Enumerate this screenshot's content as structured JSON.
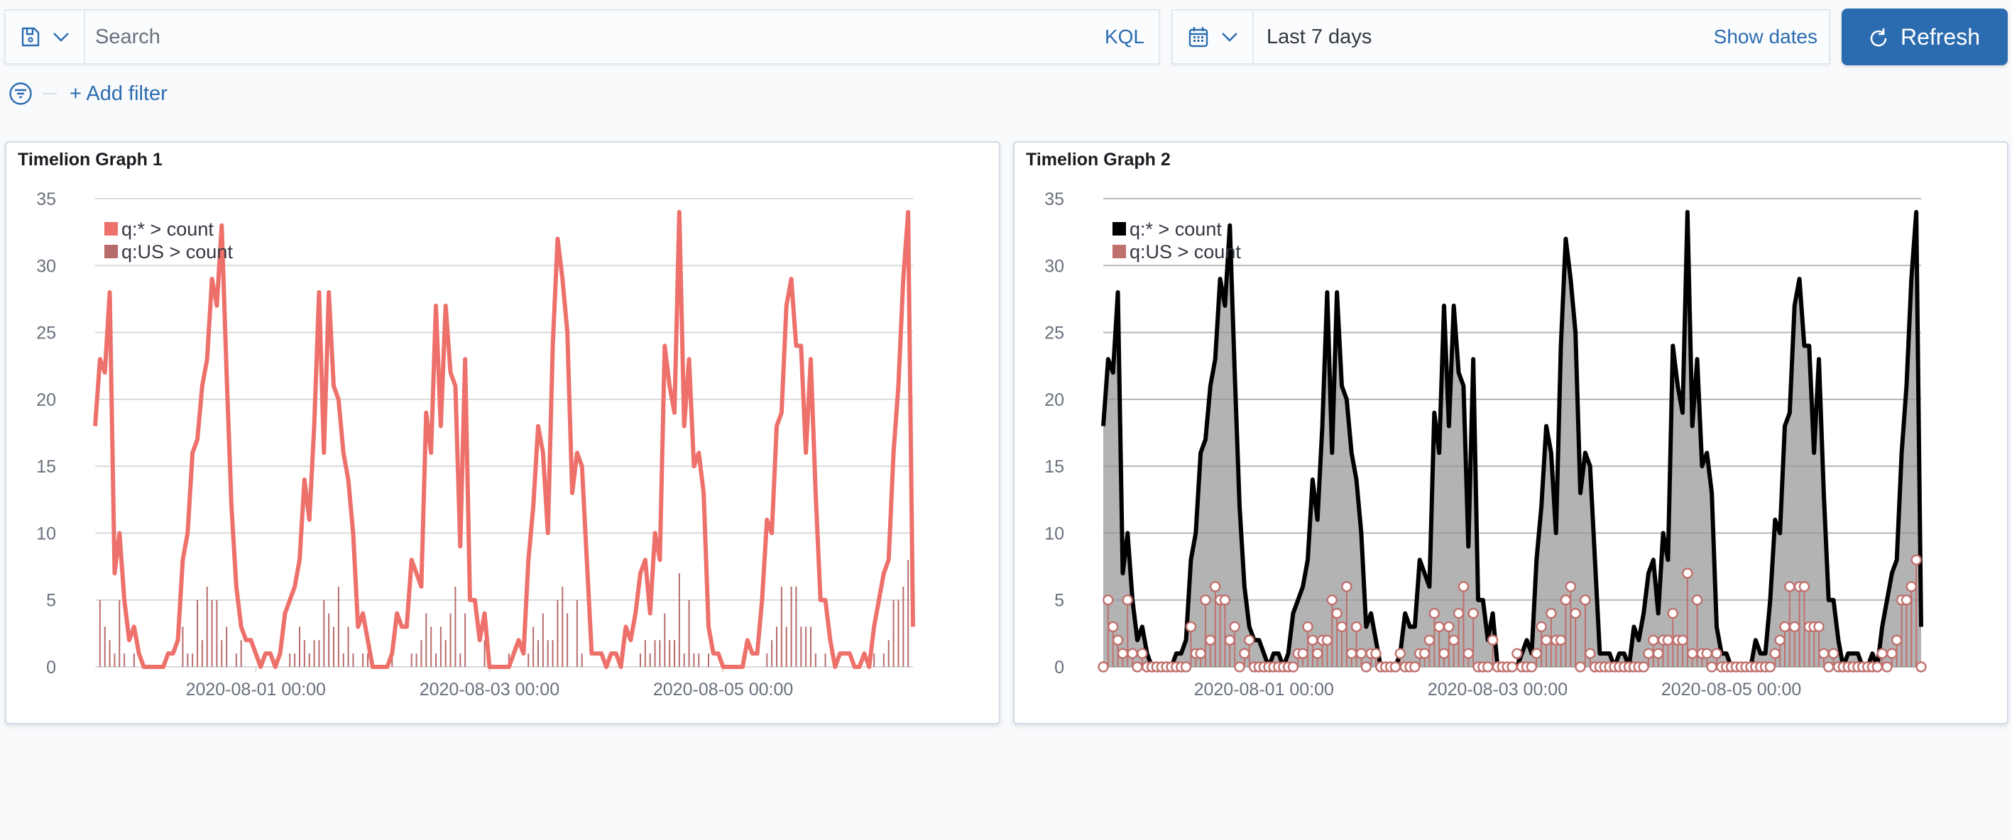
{
  "query_bar": {
    "search_placeholder": "Search",
    "search_value": "",
    "language_label": "KQL",
    "saved_query_icon": "save-icon",
    "date_picker_icon": "calendar-icon",
    "date_range": "Last 7 days",
    "show_dates_label": "Show dates",
    "refresh_label": "Refresh",
    "refresh_icon": "refresh-icon"
  },
  "filters": {
    "filter_icon": "filter-icon",
    "add_filter_label": "+ Add filter"
  },
  "colors": {
    "accent": "#2b6cb0",
    "link": "#2a6cb1",
    "graph1_total_line": "#ee706a",
    "graph1_us_bars": "#b86b6b",
    "graph2_total_line": "#000000",
    "graph2_total_fill": "#b3b3b3",
    "graph2_us_points": "#c0706d"
  },
  "panels": [
    {
      "title": "Timelion Graph 1"
    },
    {
      "title": "Timelion Graph 2"
    }
  ],
  "chart_data": [
    {
      "type": "line",
      "title": "Timelion Graph 1",
      "xlabel": "",
      "ylabel": "",
      "x_start": "2020-07-30 15:00",
      "x_interval": "1h",
      "x_end": "2020-08-06 15:00",
      "x_tick_labels": [
        "2020-08-01 00:00",
        "2020-08-03 00:00",
        "2020-08-05 00:00"
      ],
      "y_ticks": [
        0,
        5,
        10,
        15,
        20,
        25,
        30,
        35
      ],
      "ylim": [
        0,
        35
      ],
      "grid": true,
      "legend_position": "top-left",
      "series": [
        {
          "name": "q:* > count",
          "style": "line",
          "values": [
            18,
            23,
            22,
            28,
            7,
            10,
            5,
            2,
            3,
            1,
            0,
            0,
            0,
            0,
            0,
            1,
            1,
            2,
            8,
            10,
            16,
            17,
            21,
            23,
            29,
            27,
            33,
            22,
            12,
            6,
            3,
            2,
            2,
            1,
            0,
            1,
            1,
            0,
            1,
            4,
            5,
            6,
            8,
            14,
            11,
            18,
            28,
            16,
            28,
            21,
            20,
            16,
            14,
            10,
            3,
            4,
            2,
            0,
            0,
            0,
            0,
            1,
            4,
            3,
            3,
            8,
            7,
            6,
            19,
            16,
            27,
            18,
            27,
            22,
            21,
            9,
            23,
            5,
            5,
            2,
            4,
            0,
            0,
            0,
            0,
            0,
            1,
            2,
            1,
            8,
            12,
            18,
            16,
            10,
            24,
            32,
            29,
            25,
            13,
            16,
            15,
            8,
            1,
            1,
            1,
            0,
            1,
            1,
            0,
            3,
            2,
            4,
            7,
            8,
            4,
            10,
            8,
            24,
            21,
            19,
            34,
            18,
            23,
            15,
            16,
            13,
            3,
            1,
            1,
            0,
            0,
            0,
            0,
            0,
            2,
            1,
            1,
            5,
            11,
            10,
            18,
            19,
            27,
            29,
            24,
            24,
            16,
            23,
            13,
            5,
            5,
            2,
            0,
            1,
            1,
            1,
            0,
            0,
            1,
            0,
            3,
            5,
            7,
            8,
            16,
            21,
            29,
            34,
            3
          ]
        },
        {
          "name": "q:US > count",
          "style": "bars",
          "values": [
            0,
            5,
            3,
            2,
            1,
            5,
            1,
            0,
            1,
            0,
            0,
            0,
            0,
            0,
            0,
            0,
            0,
            0,
            3,
            1,
            1,
            5,
            2,
            6,
            5,
            5,
            2,
            3,
            0,
            1,
            2,
            0,
            0,
            0,
            0,
            0,
            0,
            0,
            0,
            0,
            1,
            1,
            3,
            2,
            1,
            2,
            2,
            5,
            4,
            3,
            6,
            1,
            3,
            1,
            0,
            1,
            1,
            0,
            0,
            0,
            0,
            1,
            0,
            0,
            0,
            1,
            1,
            2,
            4,
            3,
            1,
            3,
            2,
            4,
            6,
            1,
            4,
            0,
            0,
            0,
            2,
            0,
            0,
            0,
            0,
            1,
            0,
            0,
            0,
            1,
            3,
            2,
            4,
            2,
            2,
            5,
            6,
            4,
            0,
            5,
            1,
            0,
            0,
            0,
            0,
            0,
            0,
            0,
            0,
            0,
            0,
            0,
            1,
            2,
            1,
            2,
            2,
            4,
            2,
            2,
            7,
            1,
            5,
            1,
            1,
            0,
            1,
            0,
            0,
            0,
            0,
            0,
            0,
            0,
            0,
            0,
            0,
            0,
            1,
            2,
            3,
            6,
            3,
            6,
            6,
            3,
            3,
            3,
            1,
            0,
            1,
            0,
            0,
            0,
            0,
            0,
            0,
            0,
            0,
            0,
            1,
            0,
            1,
            2,
            5,
            5,
            6,
            8,
            0
          ]
        }
      ]
    },
    {
      "type": "area",
      "title": "Timelion Graph 2",
      "xlabel": "",
      "ylabel": "",
      "x_start": "2020-07-30 15:00",
      "x_interval": "1h",
      "x_end": "2020-08-06 15:00",
      "x_tick_labels": [
        "2020-08-01 00:00",
        "2020-08-03 00:00",
        "2020-08-05 00:00"
      ],
      "y_ticks": [
        0,
        5,
        10,
        15,
        20,
        25,
        30,
        35
      ],
      "ylim": [
        0,
        35
      ],
      "grid": true,
      "legend_position": "top-left",
      "series": [
        {
          "name": "q:* > count",
          "style": "area",
          "values": [
            18,
            23,
            22,
            28,
            7,
            10,
            5,
            2,
            3,
            1,
            0,
            0,
            0,
            0,
            0,
            1,
            1,
            2,
            8,
            10,
            16,
            17,
            21,
            23,
            29,
            27,
            33,
            22,
            12,
            6,
            3,
            2,
            2,
            1,
            0,
            1,
            1,
            0,
            1,
            4,
            5,
            6,
            8,
            14,
            11,
            18,
            28,
            16,
            28,
            21,
            20,
            16,
            14,
            10,
            3,
            4,
            2,
            0,
            0,
            0,
            0,
            1,
            4,
            3,
            3,
            8,
            7,
            6,
            19,
            16,
            27,
            18,
            27,
            22,
            21,
            9,
            23,
            5,
            5,
            2,
            4,
            0,
            0,
            0,
            0,
            0,
            1,
            2,
            1,
            8,
            12,
            18,
            16,
            10,
            24,
            32,
            29,
            25,
            13,
            16,
            15,
            8,
            1,
            1,
            1,
            0,
            1,
            1,
            0,
            3,
            2,
            4,
            7,
            8,
            4,
            10,
            8,
            24,
            21,
            19,
            34,
            18,
            23,
            15,
            16,
            13,
            3,
            1,
            1,
            0,
            0,
            0,
            0,
            0,
            2,
            1,
            1,
            5,
            11,
            10,
            18,
            19,
            27,
            29,
            24,
            24,
            16,
            23,
            13,
            5,
            5,
            2,
            0,
            1,
            1,
            1,
            0,
            0,
            1,
            0,
            3,
            5,
            7,
            8,
            16,
            21,
            29,
            34,
            3
          ]
        },
        {
          "name": "q:US > count",
          "style": "stem-points",
          "values": [
            0,
            5,
            3,
            2,
            1,
            5,
            1,
            0,
            1,
            0,
            0,
            0,
            0,
            0,
            0,
            0,
            0,
            0,
            3,
            1,
            1,
            5,
            2,
            6,
            5,
            5,
            2,
            3,
            0,
            1,
            2,
            0,
            0,
            0,
            0,
            0,
            0,
            0,
            0,
            0,
            1,
            1,
            3,
            2,
            1,
            2,
            2,
            5,
            4,
            3,
            6,
            1,
            3,
            1,
            0,
            1,
            1,
            0,
            0,
            0,
            0,
            1,
            0,
            0,
            0,
            1,
            1,
            2,
            4,
            3,
            1,
            3,
            2,
            4,
            6,
            1,
            4,
            0,
            0,
            0,
            2,
            0,
            0,
            0,
            0,
            1,
            0,
            0,
            0,
            1,
            3,
            2,
            4,
            2,
            2,
            5,
            6,
            4,
            0,
            5,
            1,
            0,
            0,
            0,
            0,
            0,
            0,
            0,
            0,
            0,
            0,
            0,
            1,
            2,
            1,
            2,
            2,
            4,
            2,
            2,
            7,
            1,
            5,
            1,
            1,
            0,
            1,
            0,
            0,
            0,
            0,
            0,
            0,
            0,
            0,
            0,
            0,
            0,
            1,
            2,
            3,
            6,
            3,
            6,
            6,
            3,
            3,
            3,
            1,
            0,
            1,
            0,
            0,
            0,
            0,
            0,
            0,
            0,
            0,
            0,
            1,
            0,
            1,
            2,
            5,
            5,
            6,
            8,
            0
          ]
        }
      ]
    }
  ]
}
